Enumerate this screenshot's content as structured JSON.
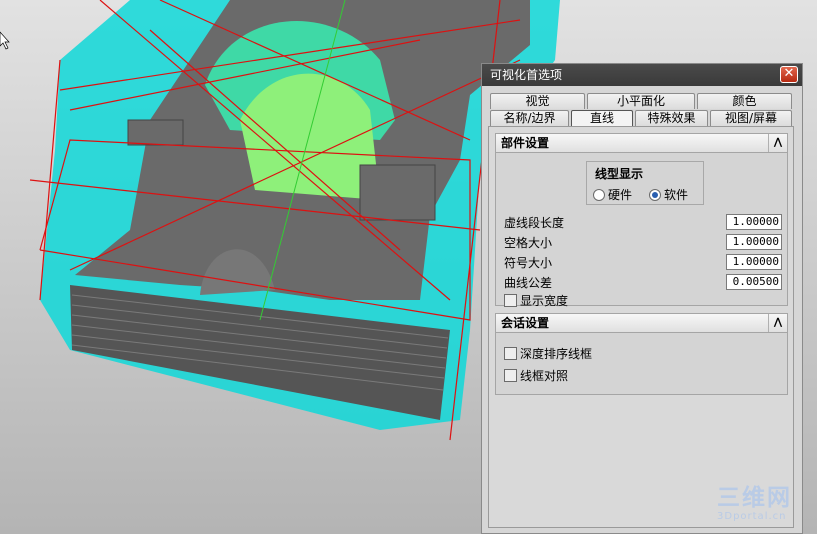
{
  "dialog": {
    "title": "可视化首选项",
    "close_label": "✕",
    "tabs_row1": [
      "视觉",
      "小平面化",
      "颜色"
    ],
    "tabs_row2": [
      "名称/边界",
      "直线",
      "特殊效果",
      "视图/屏幕"
    ],
    "active_tab": "直线"
  },
  "part_settings": {
    "header": "部件设置",
    "collapse_glyph": "⋀",
    "line_display": {
      "title": "线型显示",
      "options": [
        "硬件",
        "软件"
      ],
      "selected": "软件"
    },
    "fields": [
      {
        "label": "虚线段长度",
        "value": "1.00000"
      },
      {
        "label": "空格大小",
        "value": "1.00000"
      },
      {
        "label": "符号大小",
        "value": "1.00000"
      },
      {
        "label": "曲线公差",
        "value": "0.00500"
      }
    ],
    "show_width_label": "显示宽度",
    "show_width_checked": false
  },
  "session_settings": {
    "header": "会话设置",
    "collapse_glyph": "⋀",
    "checkboxes": [
      {
        "label": "深度排序线框",
        "checked": false
      },
      {
        "label": "线框对照",
        "checked": false
      }
    ]
  },
  "watermark": {
    "big": "三维网",
    "small": "3Dportal.cn"
  },
  "colors": {
    "toolpath_cyan": "#00e6e6",
    "toolpath_red": "#dd1111",
    "part_gray": "#5a5a5a",
    "part_top": "#6a6a6a"
  }
}
